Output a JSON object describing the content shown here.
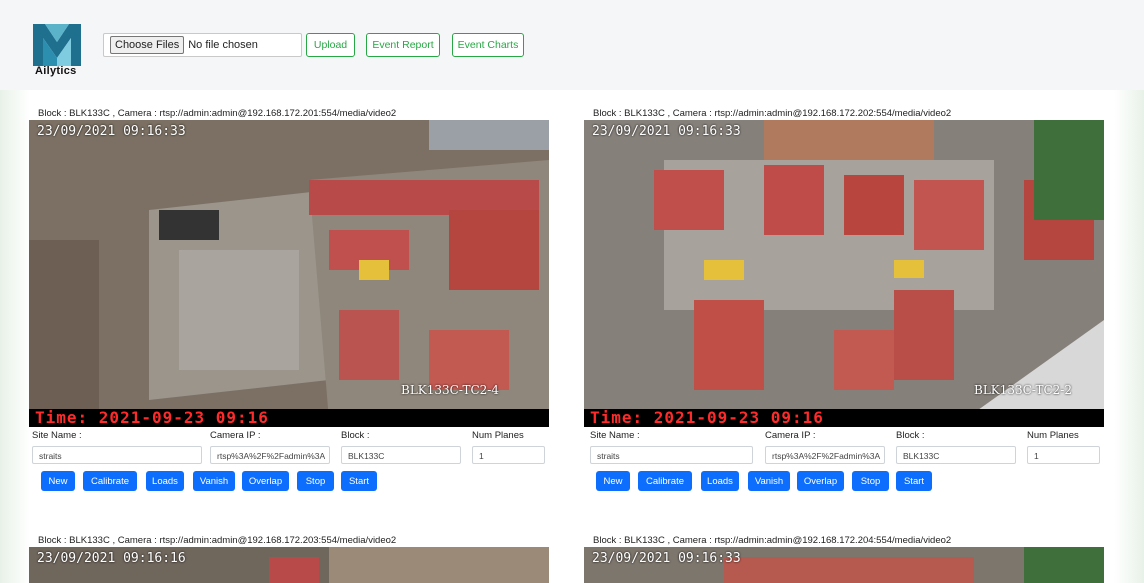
{
  "brand": {
    "name": "Ailytics"
  },
  "toolbar": {
    "file_button": "Choose Files",
    "file_status": "No file chosen",
    "upload": "Upload",
    "event_report": "Event Report",
    "event_charts": "Event Charts"
  },
  "colors": {
    "primary": "#0d6efd",
    "success": "#28a745",
    "osd_red": "#ff2a2a"
  },
  "labels": {
    "site_name": "Site Name :",
    "camera_ip": "Camera IP :",
    "block": "Block :",
    "num_planes": "Num Planes"
  },
  "buttons": {
    "new": "New",
    "calibrate": "Calibrate",
    "loads": "Loads",
    "vanish": "Vanish",
    "overlap": "Overlap",
    "stop": "Stop",
    "start": "Start"
  },
  "cameras": [
    {
      "caption": "Block : BLK133C , Camera : rtsp://admin:admin@192.168.172.201:554/media/video2",
      "osd_date": "23/09/2021  09:16:33",
      "osd_time": "Time: 2021-09-23 09:16",
      "osd_tag": "BLK133C-TC2-4",
      "site_name": "straits",
      "camera_ip": "rtsp%3A%2F%2Fadmin%3A",
      "block": "BLK133C",
      "num_planes": "1"
    },
    {
      "caption": "Block : BLK133C , Camera : rtsp://admin:admin@192.168.172.202:554/media/video2",
      "osd_date": "23/09/2021  09:16:33",
      "osd_time": "Time: 2021-09-23 09:16",
      "osd_tag": "BLK133C-TC2-2",
      "site_name": "straits",
      "camera_ip": "rtsp%3A%2F%2Fadmin%3A",
      "block": "BLK133C",
      "num_planes": "1"
    },
    {
      "caption": "Block : BLK133C , Camera : rtsp://admin:admin@192.168.172.203:554/media/video2",
      "osd_date": "23/09/2021  09:16:16"
    },
    {
      "caption": "Block : BLK133C , Camera : rtsp://admin:admin@192.168.172.204:554/media/video2",
      "osd_date": "23/09/2021  09:16:33"
    }
  ]
}
